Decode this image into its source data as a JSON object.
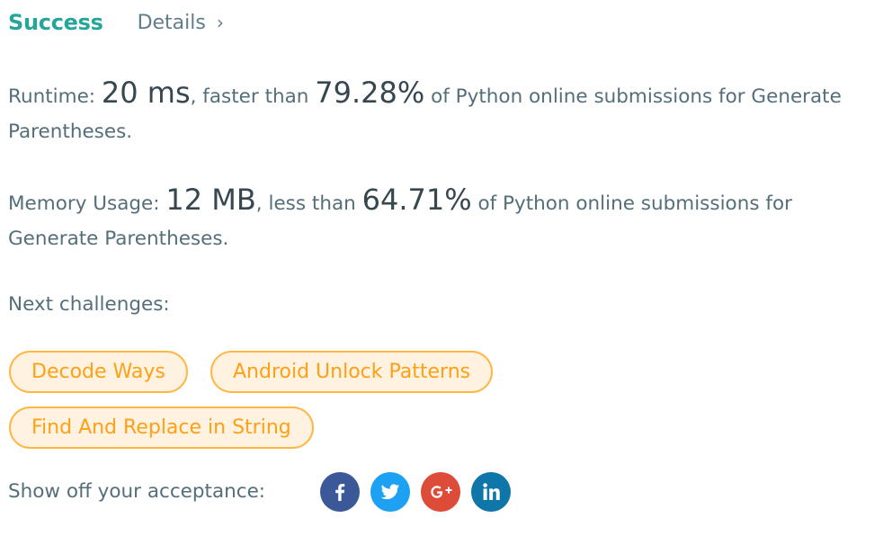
{
  "header": {
    "status": "Success",
    "details_label": "Details",
    "details_chevron": "›"
  },
  "runtime": {
    "label": "Runtime: ",
    "value": "20 ms",
    "comparison": ", faster than ",
    "percent": "79.28%",
    "suffix": " of Python online submissions for Generate Parentheses."
  },
  "memory": {
    "label": "Memory Usage: ",
    "value": "12 MB",
    "comparison": ", less than ",
    "percent": "64.71%",
    "suffix": " of Python online submissions for Generate Parentheses."
  },
  "next": {
    "label": "Next challenges:",
    "challenges": [
      {
        "label": "Decode Ways"
      },
      {
        "label": "Android Unlock Patterns"
      },
      {
        "label": "Find And Replace in String"
      }
    ]
  },
  "share": {
    "label": "Show off your acceptance:",
    "icons": [
      {
        "name": "facebook-icon",
        "color": "#3b5998"
      },
      {
        "name": "twitter-icon",
        "color": "#1da1f2"
      },
      {
        "name": "google-plus-icon",
        "color": "#dd4b39"
      },
      {
        "name": "linkedin-icon",
        "color": "#0e76a8"
      }
    ]
  },
  "colors": {
    "success": "#26a69a",
    "chip_border": "#ffb744",
    "chip_background": "#fff2e0",
    "chip_text": "#ffa015"
  }
}
